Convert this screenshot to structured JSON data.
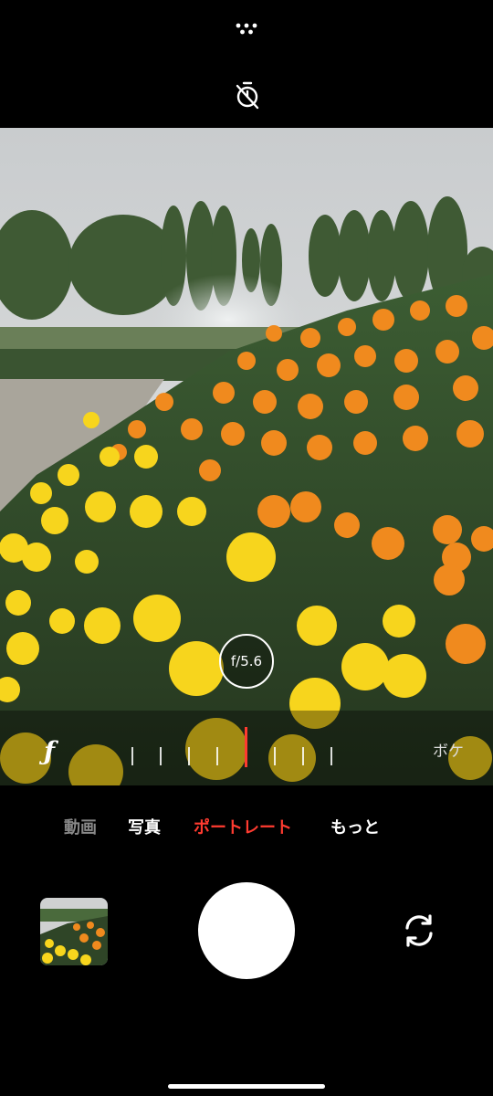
{
  "top": {
    "more_icon": "more-options-dots-icon",
    "timer_icon": "timer-off-icon"
  },
  "viewfinder": {
    "aperture_value": "f/5.6"
  },
  "aperture_ruler": {
    "f_symbol": "ƒ",
    "bokeh_label": "ボケ",
    "accent": "#ff3b30"
  },
  "modes": {
    "items": [
      "動画",
      "写真",
      "ポートレート",
      "もっと"
    ],
    "selected": "ポートレート",
    "selected_color": "#ff3b30"
  },
  "bottom": {
    "thumbnail_icon": "last-photo-thumbnail",
    "shutter_icon": "shutter-button",
    "switch_icon": "switch-camera-icon"
  }
}
